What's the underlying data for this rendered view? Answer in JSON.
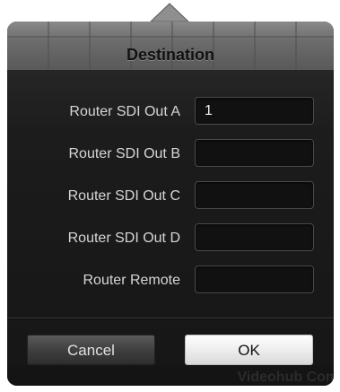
{
  "dialog": {
    "title": "Destination"
  },
  "fields": [
    {
      "label": "Router SDI Out A",
      "value": "1"
    },
    {
      "label": "Router SDI Out B",
      "value": ""
    },
    {
      "label": "Router SDI Out C",
      "value": ""
    },
    {
      "label": "Router SDI Out D",
      "value": ""
    },
    {
      "label": "Router Remote",
      "value": ""
    }
  ],
  "buttons": {
    "cancel_label": "Cancel",
    "ok_label": "OK"
  },
  "background": {
    "app_title": "Videohub Cont"
  },
  "colors": {
    "dialog_bg": "#181818",
    "header_bg": "#6c6c6c",
    "label_text": "#d6d6d6",
    "field_bg": "#111111",
    "ok_bg": "#ececec",
    "cancel_bg": "#3d3d3d"
  }
}
